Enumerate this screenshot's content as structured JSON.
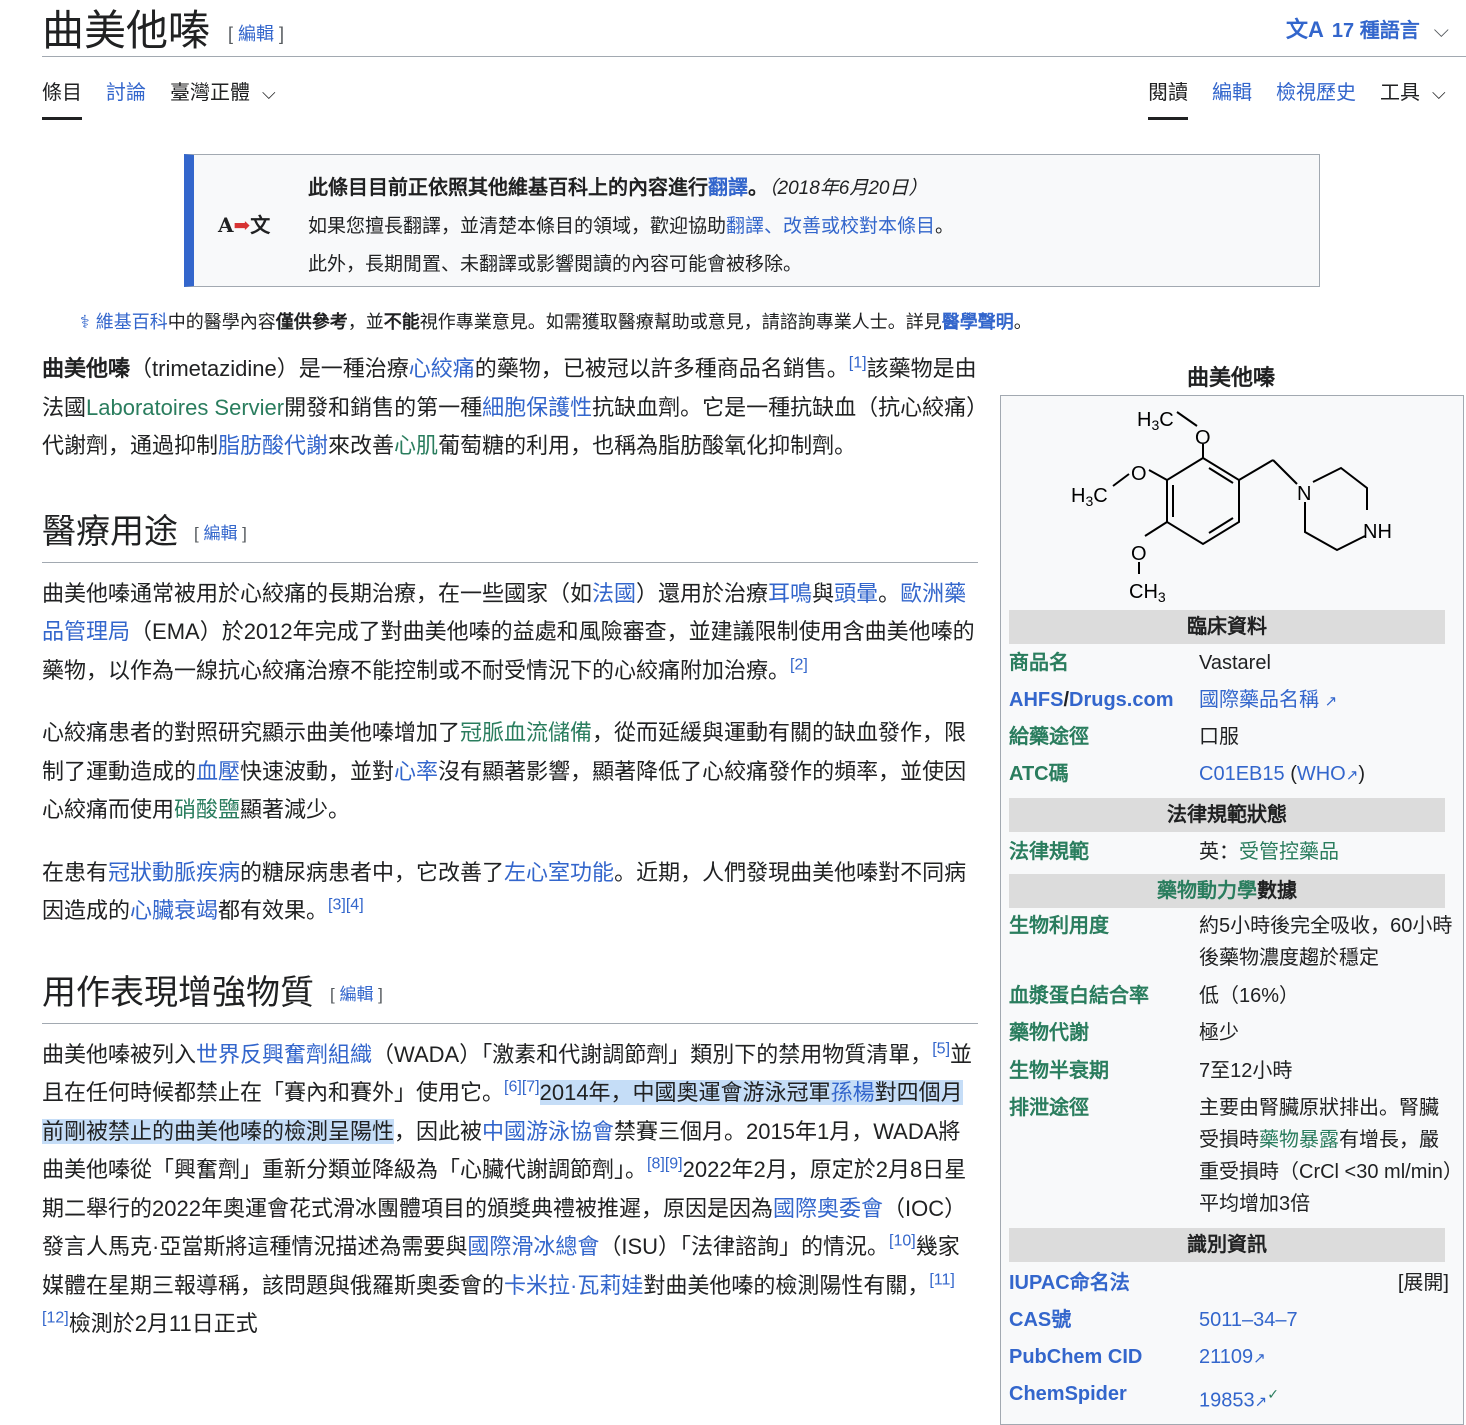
{
  "header": {
    "title": "曲美他嗪",
    "edit_label": "編輯",
    "languages": "17 種語言",
    "lang_icon": "文A"
  },
  "tabs": {
    "article": "條目",
    "talk": "討論",
    "variant": "臺灣正體",
    "read": "閱讀",
    "edit": "編輯",
    "history": "檢視歷史",
    "tools": "工具"
  },
  "notice": {
    "icon_a": "A",
    "icon_b": "文",
    "line1_prefix": "此條目目前正依照其他維基百科上的內容進行",
    "line1_link": "翻譯",
    "line1_suffix": "。",
    "line1_date": "（2018年6月20日）",
    "line2_prefix": "如果您擅長翻譯，並清楚本條目的領域，歡迎協助",
    "line2_link": "翻譯、改善或校對本條目",
    "line2_suffix": "。",
    "line3": "此外，長期閒置、未翻譯或影響閱讀的內容可能會被移除。"
  },
  "disclaimer": {
    "link1": "維基百科",
    "t1": "中的醫學內容",
    "b1": "僅供參考",
    "t2": "，並",
    "b2": "不能",
    "t3": "視作專業意見。如需獲取醫療幫助或意見，請諮詢專業人士。詳見",
    "link2": "醫學聲明",
    "t4": "。"
  },
  "intro": {
    "b": "曲美他嗪",
    "t1": "（trimetazidine）是一種治療",
    "l1": "心絞痛",
    "t2": "的藥物，已被冠以許多種商品名銷售。",
    "r1": "[1]",
    "t3": "該藥物是由法國",
    "l2": "Laboratoires Servier",
    "t4": "開發和銷售的第一種",
    "l3": "細胞保護性",
    "t5": "抗缺血劑。它是一種抗缺血（抗心絞痛）代謝劑，通過抑制",
    "l4": "脂肪酸代謝",
    "t6": "來改善",
    "l5": "心肌",
    "t7": "葡萄糖的利用，也稱為脂肪酸氧化抑制劑。"
  },
  "sec1": {
    "heading": "醫療用途",
    "edit": "編輯",
    "p1_t1": "曲美他嗪通常被用於心絞痛的長期治療，在一些國家（如",
    "p1_l1": "法國",
    "p1_t2": "）還用於治療",
    "p1_l2": "耳鳴",
    "p1_t3": "與",
    "p1_l3": "頭暈",
    "p1_t4": "。",
    "p1_l4": "歐洲藥品管理局",
    "p1_t5": "（EMA）於2012年完成了對曲美他嗪的益處和風險審查，並建議限制使用含曲美他嗪的藥物，以作為一線抗心絞痛治療不能控制或不耐受情況下的心絞痛附加治療。",
    "p1_r1": "[2]",
    "p2_t1": "心絞痛患者的對照研究顯示曲美他嗪增加了",
    "p2_l1": "冠脈血流儲備",
    "p2_t2": "，從而延緩與運動有關的缺血發作，限制了運動造成的",
    "p2_l2": "血壓",
    "p2_t3": "快速波動，並對",
    "p2_l3": "心率",
    "p2_t4": "沒有顯著影響，顯著降低了心絞痛發作的頻率，並使因心絞痛而使用",
    "p2_l4": "硝酸鹽",
    "p2_t5": "顯著減少。",
    "p3_t1": "在患有",
    "p3_l1": "冠狀動脈疾病",
    "p3_t2": "的糖尿病患者中，它改善了",
    "p3_l2": "左心室功能",
    "p3_t3": "。近期，人們發現曲美他嗪對不同病因造成的",
    "p3_l3": "心臟衰竭",
    "p3_t4": "都有效果。",
    "p3_r1": "[3]",
    "p3_r2": "[4]"
  },
  "sec2": {
    "heading": "用作表現增強物質",
    "edit": "編輯",
    "t1": "曲美他嗪被列入",
    "l1": "世界反興奮劑組織",
    "t2": "（WADA）「激素和代謝調節劑」類別下的禁用物質清單，",
    "r1": "[5]",
    "t3": "並且在任何時候都禁止在「賽內和賽外」使用它。",
    "r2": "[6]",
    "r3": "[7]",
    "h1": "2014年，中國奧運會游泳冠軍",
    "hl": "孫楊",
    "h2": "對四個月前剛被禁止的曲美他嗪的檢測呈陽性",
    "t4": "，因此被",
    "l2": "中國游泳協會",
    "t5": "禁賽三個月。2015年1月，WADA將曲美他嗪從「興奮劑」重新分類並降級為「心臟代謝調節劑」。",
    "r4": "[8]",
    "r5": "[9]",
    "t6": "2022年2月，原定於2月8日星期二舉行的2022年奧運會花式滑冰團體項目的頒獎典禮被推遲，原因是因為",
    "l3": "國際奧委會",
    "t7": "（IOC）發言人馬克·亞當斯將這種情況描述為需要與",
    "l4": "國際滑冰總會",
    "t8": "（ISU）「法律諮詢」的情況。",
    "r6": "[10]",
    "t9": "幾家媒體在星期三報導稱，該問題與俄羅斯奧委會的",
    "l5": "卡米拉·瓦莉娃",
    "t10": "對曲美他嗪的檢測陽性有關，",
    "r7": "[11]",
    "r8": "[12]",
    "t11": "檢測於2月11日正式"
  },
  "infobox": {
    "caption": "曲美他嗪",
    "structure": {
      "h3c_top": "H3C",
      "h3c_left": "H3C",
      "ch3": "CH3",
      "o1": "O",
      "o2": "O",
      "o3": "O",
      "n": "N",
      "nh": "NH"
    },
    "sec_clinical": "臨床資料",
    "tradename_k": "商品名",
    "tradename_v": "Vastarel",
    "ahfs_k1": "AHFS",
    "ahfs_sep": "/",
    "ahfs_k2": "Drugs.com",
    "ahfs_v": "國際藥品名稱",
    "route_k": "給藥途徑",
    "route_v": "口服",
    "atc_k": "ATC碼",
    "atc_v1": "C01EB15",
    "atc_v2": "(",
    "atc_v3": "WHO",
    "atc_v4": ")",
    "sec_legal": "法律規範狀態",
    "legal_k": "法律規範",
    "legal_v1": "英：",
    "legal_v2": "受管控藥品",
    "sec_pk_link": "藥物動力學",
    "sec_pk_text": "數據",
    "bio_k": "生物利用度",
    "bio_v": "約5小時後完全吸收，60小時後藥物濃度趨於穩定",
    "pb_k": "血漿蛋白結合率",
    "pb_v": "低（16%）",
    "met_k": "藥物代謝",
    "met_v": "極少",
    "hl_k": "生物半衰期",
    "hl_v": "7至12小時",
    "exc_k": "排泄途徑",
    "exc_v1": "主要由腎臟原狀排出。腎臟受損時",
    "exc_l": "藥物暴露",
    "exc_v2": "有增長，嚴重受損時（CrCl <30 ml/min）平均增加3倍",
    "sec_id": "識別資訊",
    "iupac_k": "IUPAC命名法",
    "iupac_v": "[展開]",
    "cas_k": "CAS號",
    "cas_v": "5011–34–7",
    "pubchem_k": "PubChem CID",
    "pubchem_v": "21109",
    "chemspider_k": "ChemSpider",
    "chemspider_v": "19853",
    "check": "✓"
  },
  "colors": {
    "link": "#3366cc",
    "link_visited_green": "#2a7d5e",
    "red_link": "#d73333",
    "highlight": "#c5ddf7"
  }
}
